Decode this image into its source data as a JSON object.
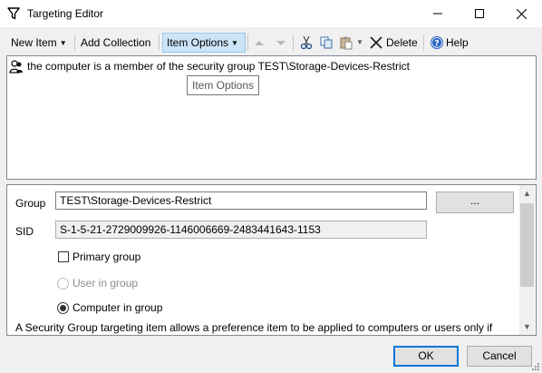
{
  "window": {
    "title": "Targeting Editor",
    "title_icon": "filter-funnel-icon"
  },
  "toolbar": {
    "new_item": "New Item",
    "add_collection": "Add Collection",
    "item_options": "Item Options",
    "delete": "Delete",
    "help": "Help"
  },
  "targeting_list": {
    "items": [
      {
        "text": "the computer is a member of the security group TEST\\Storage-Devices-Restrict",
        "icon": "security-group-icon"
      }
    ]
  },
  "tooltip": {
    "text": "Item Options"
  },
  "properties": {
    "group_label": "Group",
    "group_value": "TEST\\Storage-Devices-Restrict",
    "browse_label": "...",
    "sid_label": "SID",
    "sid_value": "S-1-5-21-2729009926-1146006669-2483441643-1153",
    "primary_group_label": "Primary group",
    "primary_group_checked": false,
    "user_in_group_label": "User in group",
    "computer_in_group_label": "Computer in group",
    "selected_scope": "Computer in group",
    "description": "A Security Group targeting item allows a preference item to be applied to computers or users only if"
  },
  "buttons": {
    "ok": "OK",
    "cancel": "Cancel"
  },
  "colors": {
    "accent": "#0078d7",
    "toolbar_active": "#cce4f7"
  }
}
